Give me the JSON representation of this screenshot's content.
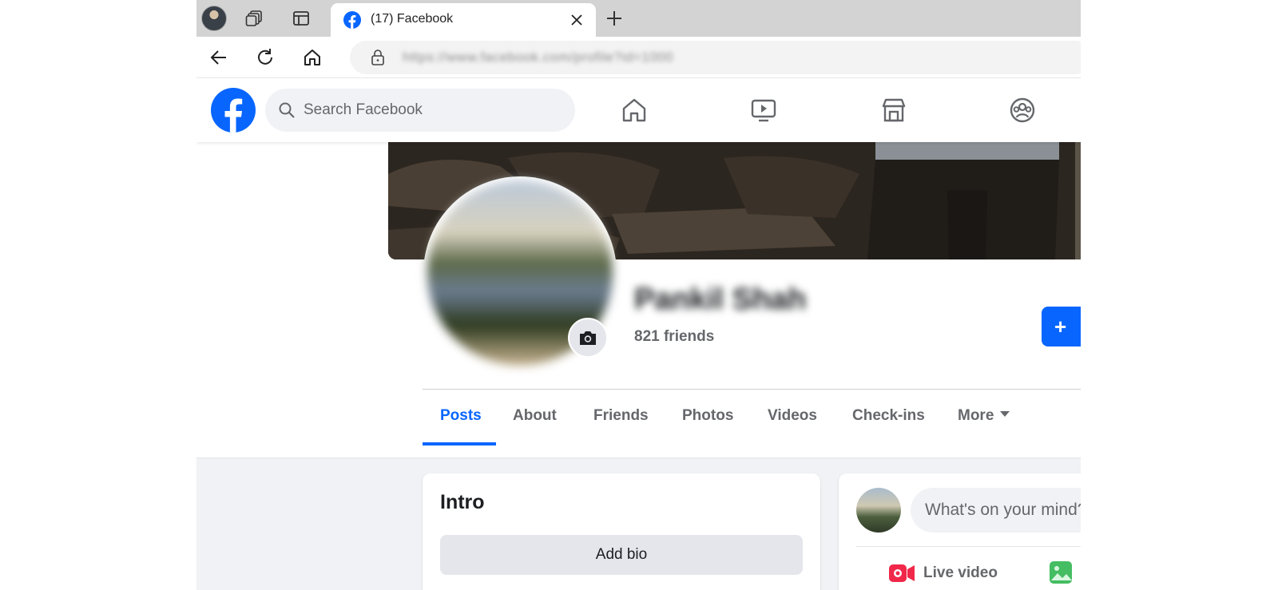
{
  "browser": {
    "tab_title": "(17) Facebook",
    "url": "https://www.facebook.com/profile?id=1000"
  },
  "header": {
    "search_placeholder": "Search Facebook"
  },
  "profile": {
    "name": "Pankil Shah",
    "friends": "821 friends",
    "add_label": "+"
  },
  "tabs": [
    {
      "label": "Posts",
      "active": true
    },
    {
      "label": "About"
    },
    {
      "label": "Friends"
    },
    {
      "label": "Photos"
    },
    {
      "label": "Videos"
    },
    {
      "label": "Check-ins"
    },
    {
      "label": "More"
    }
  ],
  "intro": {
    "title": "Intro",
    "add_bio": "Add bio"
  },
  "composer": {
    "placeholder": "What's on your mind?",
    "live_video": "Live video"
  },
  "colors": {
    "brand": "#0866ff",
    "live": "#f02849",
    "photo": "#45bd62"
  }
}
